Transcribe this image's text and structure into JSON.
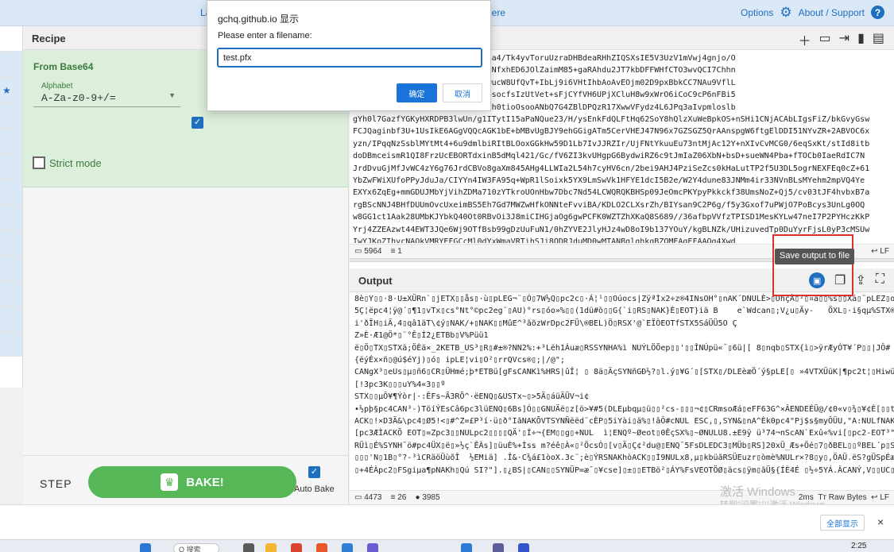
{
  "banner": {
    "left_text": "La",
    "mid_text": "here",
    "options_label": "Options",
    "about_label": "About / Support",
    "help_glyph": "?"
  },
  "recipe": {
    "title": "Recipe",
    "operation": {
      "title": "From Base64",
      "alphabet_label": "Alphabet",
      "alphabet_value": "A-Za-z0-9+/=",
      "remove_nonalpha_checked": true,
      "strict_mode_label": "Strict mode",
      "strict_mode_checked": false
    },
    "step_label": "STEP",
    "bake_label": "BAKE!",
    "auto_bake_label": "Auto Bake",
    "auto_bake_checked": true
  },
  "input": {
    "lines": [
      "1/QCAuM71srl118ySxdfH7mfpH4jsa4/Tk4yvToruUzraDHBdeaRHhZIQSXsIE5V3UzV1mVwj4gnjo/O",
      "mz7/csZ501SltFCemqZK1KR76//JeNfxhED6JOlZaimM85+gaRAhdu2JT7kbDFFWHfCTO3wvQCI7Chhn",
      "+VtnHBhL7CWkaB6h+86moK0g0OSDwucW8UfQvT+IbLj9i6VHtIhbAoAvEOjm02D9pxBbkCC7NAu9VflL",
      "Wbw0qzOVmLoKAp+MtdWltt3ycny3OsocfsIzUtVet+sFjCYfVH6UPjXCluH8w9xWrO6iCoC9cP6nFBi5",
      "AMLrlnpb9j6lIzUoELVicbWZ+oGEsh0tioOsooANbQ7G4ZBlDPQzR17XwwVFydz4L6JPq3aIvpmloslb",
      "gYh0l7GazfYGKyHXRDPB3lwUn/g1ITytI15aPaNQue23/H/ysEnkFdQLFtHq62SoY8hQlzXuWeBpkOS+nSHi1CNjACAbLIgsFiZ/bkGvyGsw",
      "FCJQaginbf3U+1UsIkE6AGgVQQcAGK1bE+bMBvUgBJY9ehGGigATm5CerVHEJ47N96x7GZSGZ5QrAAnspgW6ftgElDDI51NYvZR+2ABVOC6x",
      "yzn/IPqqNzSsblMYtMt4+6u9dmlbiRItBLOoxGGkHw59D1Lb7IvJJRZIr/UjFNtYkuuEu73ntMjAc12Y+nXIvCvMCG0/6eqSxKt/stId8itb",
      "doDBmceismR1QI8FrzUcEBORTdxinB5dMql421/Gc/fV6ZI3kvUHgpG6BydwiRZ6c9tJmIaZ06XbN+bsD+sueWN4Pba+fTOCb0IaeRdIC7N",
      "JrdDvuGjMfJvWC4zY6g76JrdCBVo8gaXm845AHg4LLWIa2L54h7cyHV6cn/2bei9AHJ4PziSeZcs0kHaLutTP2f5U3DL5ogrNEXFEq0cZ+61",
      "YbZwFWiXUfoPPyJduJa/CIYYn4IW3FA95q+WpR1lSoixk5YX9LmSwVk1HFYE1dcI5B2e/W2Y4dune83JNMm4ir33NVnBLsMYehm2mpVQ4Ye",
      "EXYx6ZqEg+mmGDUJMbYjVihZDMa710zYTkroUOnHbw7Dbc7Nd54LCWQRQKBHSp09JeOmcPKYpyPkkckf38UmsNoZ+Qj5/cv03tJF4hvbxB7a",
      "rgBScNNJ4BHfDUUmOvcUxeimBS5Eh7Gd7MWZwHfkONNteFvviBA/KDLO2CLXsrZh/BIYsan9C2P6g/f5y3Gxof7uPWjO7PoBcys3UnLg0OQ",
      "w8GG1ct1Aak28UMbKJYbkQ40Ot0RBvOi3J8miCIHGjaOg6gwPCFK0WZTZhXKaQ8S689//36afbpVVfzTPISD1MesKYLw47neI7P2PYHczKkP",
      "Yrj4ZZEAzwt44EWT3JQe6Wj9OTfBsb99gDzUuFuN1/0hZYVE2JlyHJz4wD8oI9b137YOuY/kgBLNZk/UHizuvedTp0DuYyrFjsL0yP3cMSUw",
      "IwYJKoZIhvcNAQkVMRYEFGCcMl0dYxWmaVRTihSJi8ODRJduMD0wMTANBglghkgBZQMEAgEFAAQg4Xwd"
    ],
    "status_chars": "5964",
    "status_lines": "1",
    "status_right": "LF"
  },
  "output": {
    "title": "Output",
    "save_tooltip": "Save output to file",
    "lines": [
      "8è▯Y▯▯·8·U±XÜRn`▯jETX▯▯ås▯·ù▯pLEG¬¨▯Ó▯7W½Q▯pc2c▯·Á¦¹▯▯Oúocs|ZÿªÌx2÷z®4INsOH°▯nAK´DNULÈ>▯OhçÀ▯²▯¤a▯▯%s▯▯Xá▯¨pLEZ▯oa▯",
      "5Ç¦ëpc4¦ÿ@´▯¶1▯vTx▯cs°Nt°©pc2eg¨▯AU)°rs▯óo»%▯▯(1dü#ò▯▯G{`i▯RS▯NAK}È▯EOT}iä B    e`Wdcan▯;V¿u▯Äy-   ÖXL▯·i§qµ%STX®BsUFS",
      "i'ðÏH▯iÄ,4▯qâ1äT\\¢ý▯NAK/+▯NAK▯▯MûE^³ãõzWrDpc2FÜ\\®BEL)Ö▯RSX'@`EÏÒEOTfSTX5SáÜÜ5O Ç",
      "Z»È·Æ1@Ö*▯¨°Ê▯Í2¿ETBb▯V%Püü1",
      "ë▯Ö▯TX▯STXä;ÖÈä×_2KETB_US³▯R▯#±®?NN2%:+³Lëh1Áuæ▯RSSYNHA%ì NUÝLÖÕep▯▯'▯▯ÎNÚpü«¯▯6ü|[ 8▯nqb▯STX{ì▯>ÿrÆyÓT¥´P▯▯|JÔ#",
      "{ëýÉx×ñ▯@ú$éYj)▯ó▯ ipLE¦vi▯O²▯rrQVcs®▯;|/@\";",
      "CANgX³▯eUs▯µ▯ñ6▯CR▯ÜHmé;þ*ETBü[gFsCANKì%HRS|ûÎ¦ ▯ 8ä▯ÄçSYNñGÐ½?▯l.ý▯¥G´▯[STX▯/DLEèæÖ´ý§pLE[▯ »4VTXÜüK|¶pc2t¦▯Hiwüæpc3",
      "[!3pc3K▯▯▯uY%4«3▯▯º",
      "STX▯▯µÖ¥¶Ýòr|·:ÊFs~Ã3RÕ^·ëENQ▯&USTx~▯>5Ä▯áüÄÜV¬i¢",
      "•½pþ§pc4CAN³-)TöíÝEsCâ6pc3lüENQ▯6Bs]Ó▯▯GNUÄë▯z[ö>¥#5(DLEµbqµ▯ü▯▯²cs-▯▯▯¬¢▯CRmsoÆá▯eFF63G^×ÂENDEÉÜ@/¢0«v▯¾▯¥¢È[▯▯t▯±▯Íö",
      "ACK▯!×D3Ä&\\pc4▯Ø5!<▯#^Z=£P³í·ü▯ð°IãNAKÕVTSYNÑëëd¨cÈP▯5iYài▯ä%▯!âÔ#cNUL ESC,▯,SYN&▯nA^Èk0pc4\"Pj$s§myÔÜU,\"A:NULfNAKAEMLNULCAN▯",
      "[pc3ÆÌACKÕ EOT▯=Zpc3▯▯NULpc2▯▯▯▯QÄ'▯Í÷¬{EM▯▯g▯+NUL  ì¦ENQº~Øeot▯0ÊçSX%▯~ØNULU8.±E9ÿ ü³74¬nScAN`Exû«%vi[▯pc2-EOT³\"Äa#USSO}SI",
      "RÜì▯É%SYNH¯ö#pc4ÜX▯ë▯»½ç`ÊÀs]▯üuÈ%+Ìss m?éê▯À«▯²ÖcsÒ▯[v▯Ä▯Ç¢²du@▯ENQ¯5FsDLEDC3▯MÜb▯RS]20xÜ_Æs+Öé▯7▯ðBEL▯▯ºBEL´p▯SYNzsÜI",
      "▯▯▯'N▯1B▯°?-³ìCRäöÜùõÎ  ½EMiä] .Î&·C¾á£1òoX.3c¨;è▯ÝRSNAKhòACK▯▯Ì9NULx8,µ▯kbüãRSÜEuzr▯òmè%NULr×?8▯y▯,ÖAÜ.ëS?gÜSpÉæ",
      "▯+4ÉÀpc2▯FSgiµa¶pNAKh▯Qú SI?\"].▯¿BS|▯CAN▯▯SYNÜP=æ¯▯¥cse]▯±▯▯ETBö²▯ÁY%FsVEOTÖØ▯äcs▯ÿm▯ãÜ§{ÍÈ4É ▯½÷5YÁ.ÂCANÝ,V▯▯UC▯RSpc1V1é"
    ],
    "status_chars": "4473",
    "status_lines": "26",
    "status_pos": "3985",
    "status_time": "2ms",
    "status_encoding": "Raw Bytes",
    "status_right": "LF"
  },
  "watermark": {
    "line1": "激活 Windows",
    "line2": "转到\"设置\"以激活 Windows。"
  },
  "dialog": {
    "title": "gchq.github.io 显示",
    "prompt": "Please enter a filename:",
    "input_value": "test.pfx",
    "ok_label": "确定",
    "cancel_label": "取消"
  },
  "download_bar": {
    "show_all_label": "全部显示",
    "close_glyph": "×"
  },
  "taskbar": {
    "search_placeholder": "Q 搜索",
    "clock": "2:25"
  },
  "colors": {
    "accent": "#1f6fbf",
    "bake": "#55b755",
    "operation_bg": "#dcefdb",
    "highlight": "#d9332a"
  },
  "icons": [
    "gear-icon",
    "help-icon",
    "plus-icon",
    "folder-icon",
    "import-icon",
    "trash-icon",
    "layout-icon",
    "save-icon",
    "copy-icon",
    "replace-input-icon",
    "maximize-icon",
    "chef-icon"
  ]
}
